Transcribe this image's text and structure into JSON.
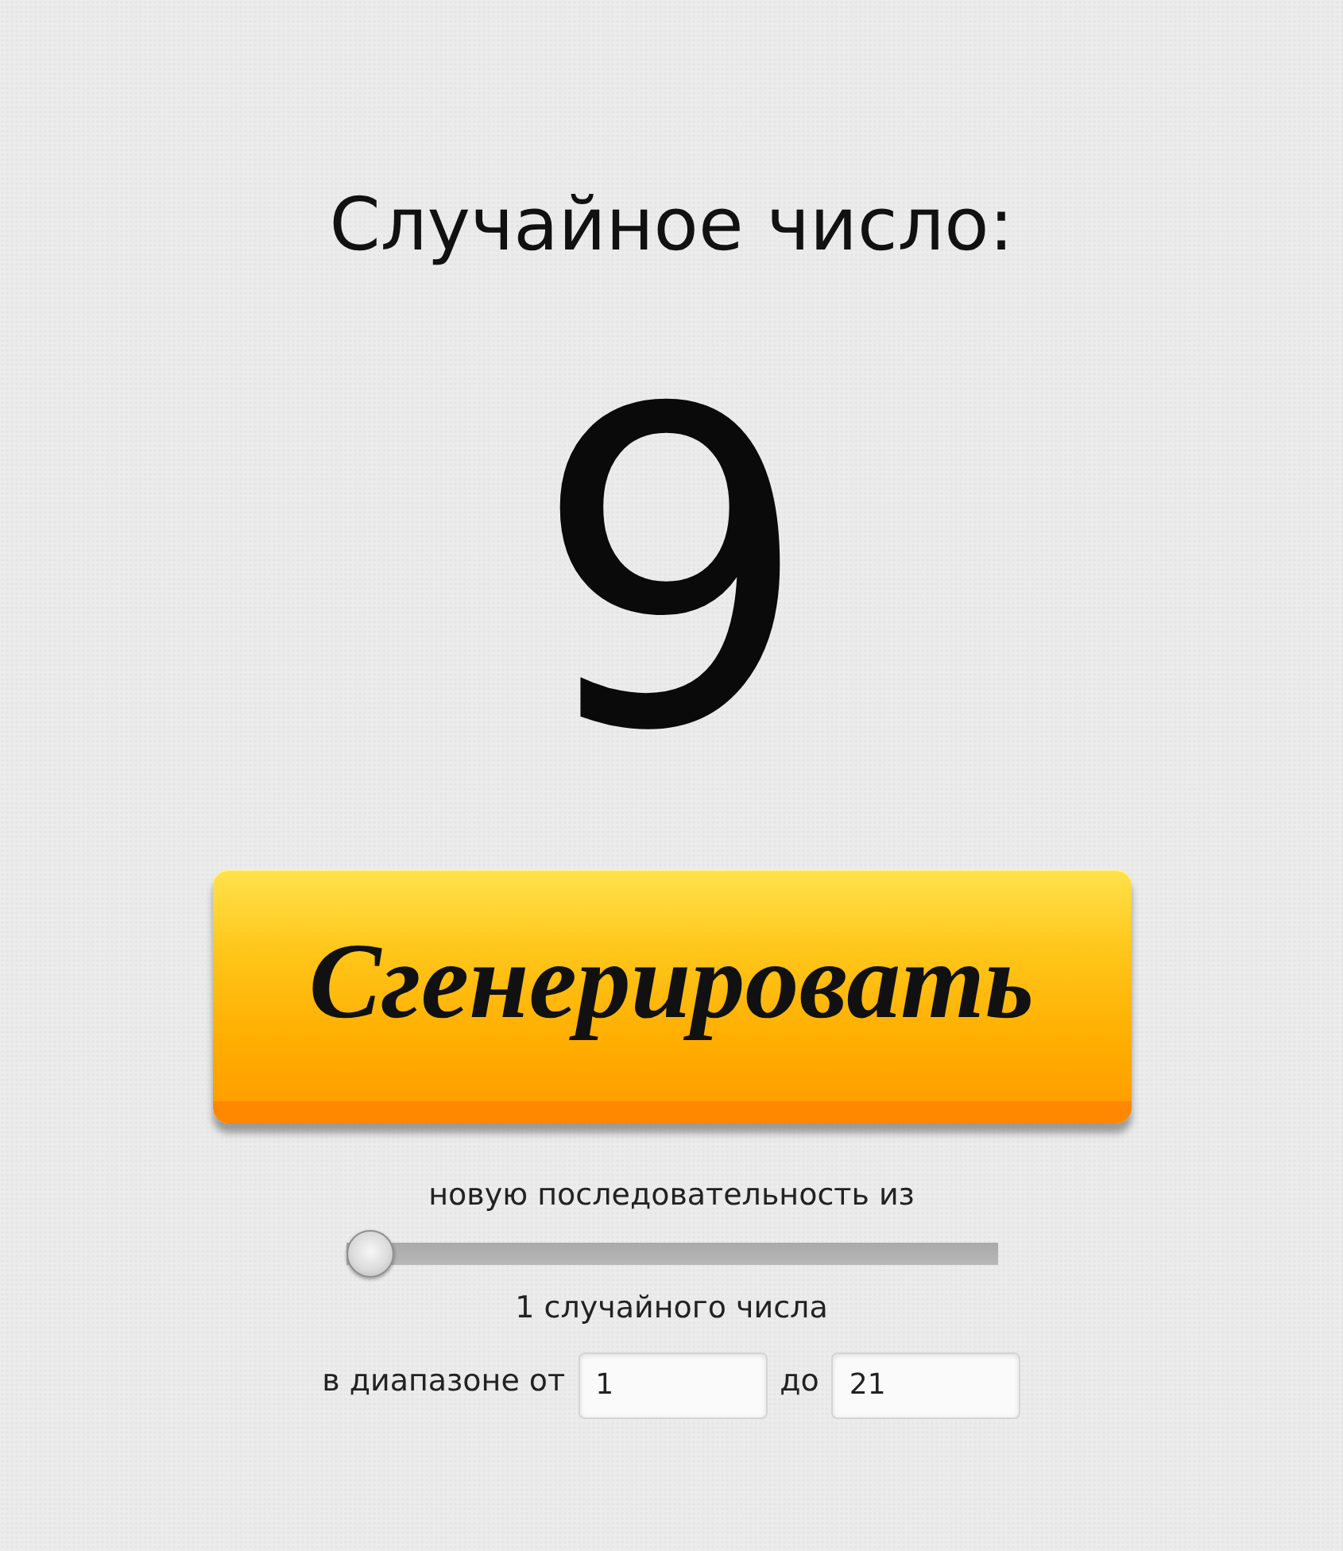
{
  "result": {
    "title": "Случайное число:",
    "value": "9"
  },
  "generate_button": {
    "label": "Сгенерировать"
  },
  "sequence": {
    "label": "новую последовательность из",
    "slider": {
      "level": 0
    },
    "count_text": "1 случайного числа"
  },
  "range": {
    "from_label": "в диапазоне от",
    "from_value": "1",
    "to_label": "до",
    "to_value": "21"
  }
}
